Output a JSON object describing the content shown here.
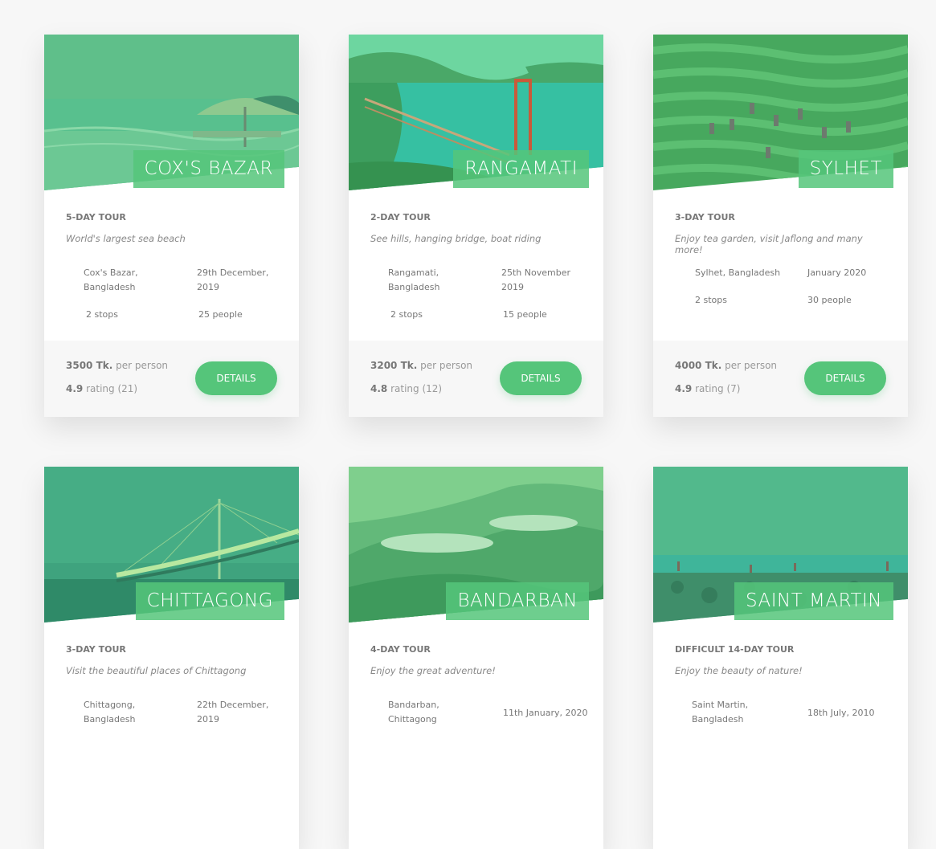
{
  "tours": [
    {
      "name": "COX'S BAZAR",
      "length": "5-DAY TOUR",
      "tagline": "World's largest sea beach",
      "location": "Cox's Bazar, Bangladesh",
      "date": "29th December, 2019",
      "stops": "2 stops",
      "people": "25 people",
      "price": "3500 Tk.",
      "price_unit": "per person",
      "rating": "4.9",
      "rating_label": "rating (21)",
      "button": "DETAILS"
    },
    {
      "name": "RANGAMATI",
      "length": "2-DAY TOUR",
      "tagline": "See hills, hanging bridge, boat riding",
      "location": "Rangamati, Bangladesh",
      "date": "25th November 2019",
      "stops": "2 stops",
      "people": "15 people",
      "price": "3200 Tk.",
      "price_unit": "per person",
      "rating": "4.8",
      "rating_label": "rating (12)",
      "button": "DETAILS"
    },
    {
      "name": "SYLHET",
      "length": "3-DAY TOUR",
      "tagline": "Enjoy tea garden, visit Jaflong and many more!",
      "location": "Sylhet, Bangladesh",
      "date": "January 2020",
      "stops": "2 stops",
      "people": "30 people",
      "price": "4000 Tk.",
      "price_unit": "per person",
      "rating": "4.9",
      "rating_label": "rating (7)",
      "button": "DETAILS"
    },
    {
      "name": "CHITTAGONG",
      "length": "3-DAY TOUR",
      "tagline": "Visit the beautiful places of Chittagong",
      "location": "Chittagong, Bangladesh",
      "date": "22th December, 2019"
    },
    {
      "name": "BANDARBAN",
      "length": "4-DAY TOUR",
      "tagline": "Enjoy the great adventure!",
      "location": "Bandarban, Chittagong",
      "date": "11th January, 2020"
    },
    {
      "name": "SAINT MARTIN",
      "length": "DIFFICULT 14-DAY TOUR",
      "tagline": "Enjoy the beauty of nature!",
      "location": "Saint Martin, Bangladesh",
      "date": "18th July, 2010"
    }
  ],
  "colors": {
    "accent": "#55c57a",
    "accent_dark": "#28b485"
  }
}
